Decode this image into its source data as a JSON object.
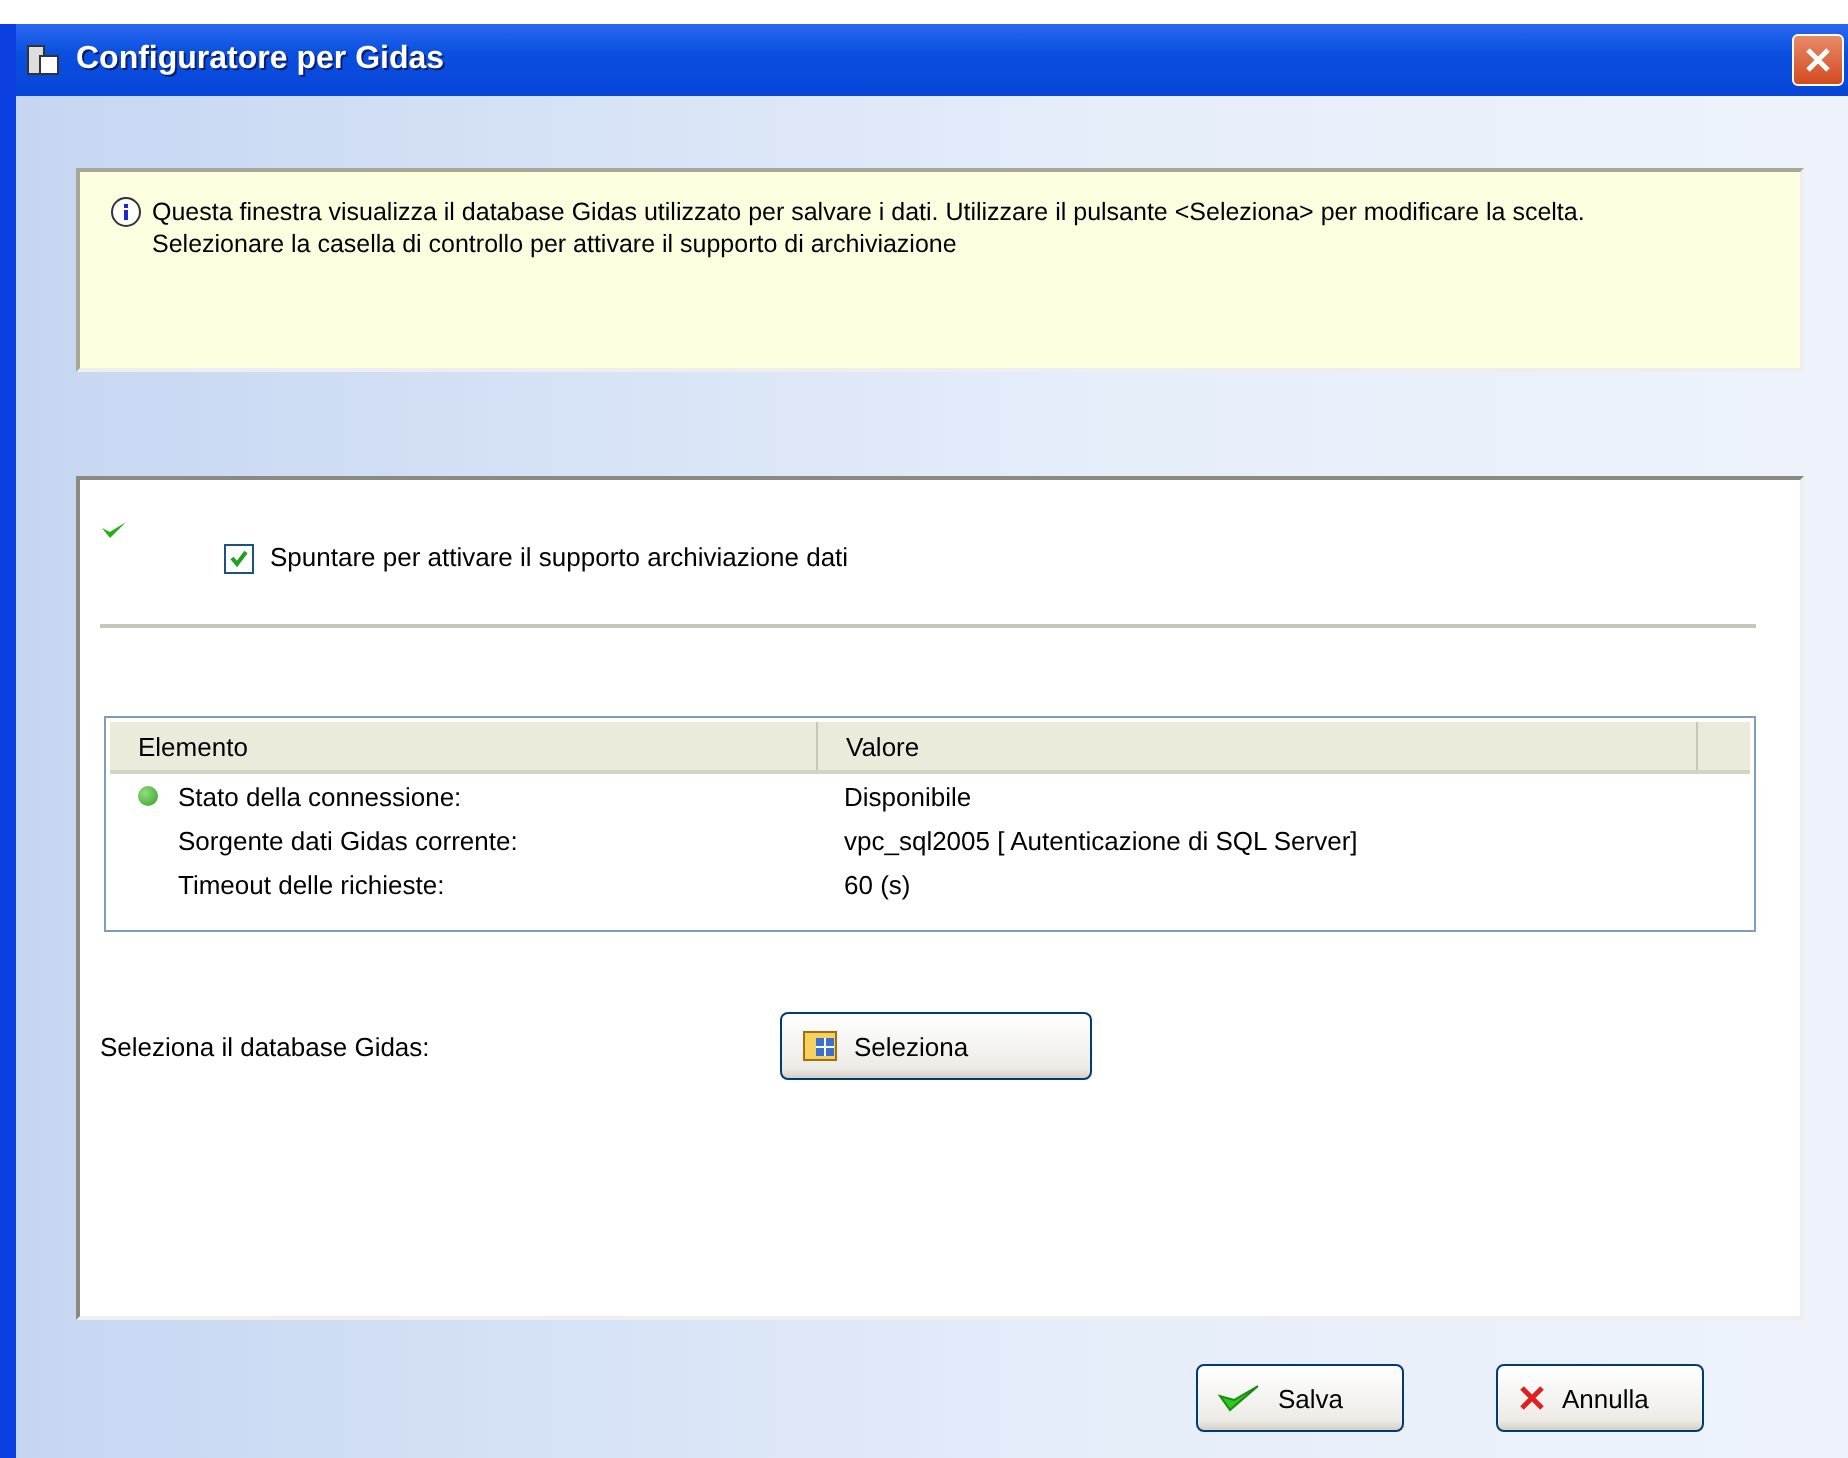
{
  "window": {
    "title": "Configuratore per Gidas"
  },
  "info": {
    "text": "Questa finestra visualizza il database Gidas utilizzato per salvare i dati. Utilizzare il pulsante <Seleziona> per modificare la scelta. Selezionare la casella di controllo per attivare il supporto di archiviazione"
  },
  "archive_checkbox": {
    "label": "Spuntare per attivare il supporto archiviazione dati",
    "checked": true
  },
  "table": {
    "columns": [
      "Elemento",
      "Valore"
    ],
    "rows": [
      {
        "element": "Stato della connessione:",
        "value": "Disponibile",
        "status_dot": true
      },
      {
        "element": "Sorgente dati Gidas corrente:",
        "value": "vpc_sql2005 [ Autenticazione di SQL Server]",
        "status_dot": false
      },
      {
        "element": "Timeout delle richieste:",
        "value": "60 (s)",
        "status_dot": false
      }
    ]
  },
  "select_database": {
    "label": "Seleziona il database Gidas:",
    "button": "Seleziona"
  },
  "buttons": [
    {
      "kind": "ok",
      "label": "Salva"
    },
    {
      "kind": "cancel",
      "label": "Annulla"
    }
  ]
}
